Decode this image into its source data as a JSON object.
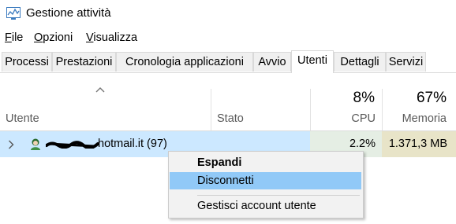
{
  "window": {
    "title": "Gestione attività",
    "icon": "task-manager-icon"
  },
  "menu": [
    {
      "label_underlined": "F",
      "label_rest": "ile"
    },
    {
      "label_underlined": "O",
      "label_rest": "pzioni"
    },
    {
      "label_underlined": "V",
      "label_rest": "isualizza"
    }
  ],
  "tabs": [
    "Processi",
    "Prestazioni",
    "Cronologia applicazioni",
    "Avvio",
    "Utenti",
    "Dettagli",
    "Servizi"
  ],
  "active_tab": "Utenti",
  "columns": {
    "user": "Utente",
    "status": "Stato",
    "cpu": {
      "percent": "8%",
      "label": "CPU"
    },
    "memory": {
      "percent": "67%",
      "label": "Memoria"
    }
  },
  "row": {
    "user_visible": "hotmail.it (97)",
    "status": "",
    "cpu": "2.2%",
    "memory": "1.371,3 MB"
  },
  "context_menu": {
    "items": [
      "Espandi",
      "Disconnetti",
      "Gestisci account utente"
    ],
    "default_item": "Espandi",
    "highlighted_item": "Disconnetti"
  },
  "colors": {
    "row_selected": "#cce8ff",
    "cpu_cell": "#e5eee4",
    "memory_cell": "#e8e4c8",
    "menu_highlight": "#91c9f7"
  }
}
